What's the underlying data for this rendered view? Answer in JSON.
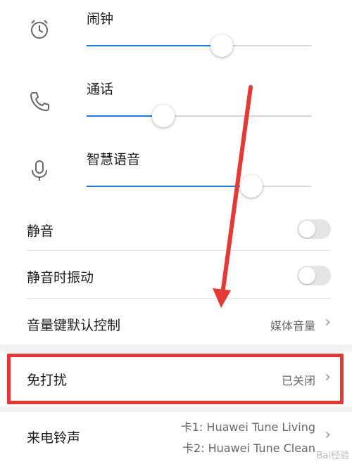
{
  "volume": [
    {
      "label": "闹钟",
      "icon": "alarm-clock-icon",
      "level": 0.6
    },
    {
      "label": "通话",
      "icon": "phone-icon",
      "level": 0.34
    },
    {
      "label": "智慧语音",
      "icon": "microphone-icon",
      "level": 0.73
    }
  ],
  "settings": {
    "mute": {
      "label": "静音",
      "on": false
    },
    "vibrate_on_mute": {
      "label": "静音时振动",
      "on": false
    },
    "volume_key_default": {
      "label": "音量键默认控制",
      "value": "媒体音量"
    },
    "do_not_disturb": {
      "label": "免打扰",
      "value": "已关闭"
    },
    "ringtone": {
      "label": "来电铃声",
      "sim1": "卡1: Huawei Tune Living",
      "sim2": "卡2: Huawei Tune Clean"
    }
  },
  "watermark": "Bai经验",
  "colors": {
    "accent": "#1e7be0",
    "annotation": "#e53935"
  }
}
